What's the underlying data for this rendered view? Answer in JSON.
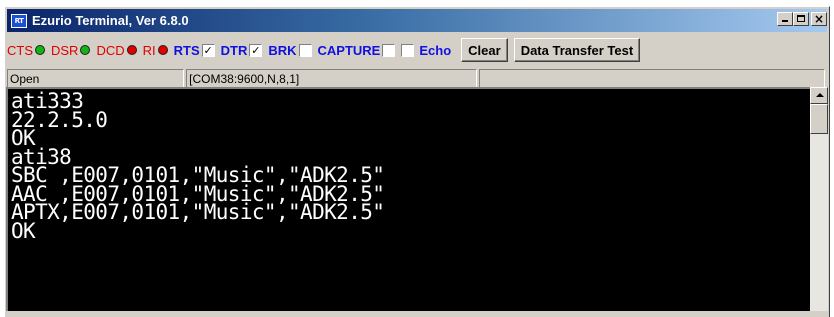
{
  "window": {
    "title": "Ezurio Terminal, Ver 6.8.0",
    "icon_text": "RT",
    "controls": [
      "minimize-icon",
      "maximize-icon",
      "close-icon"
    ],
    "close_glyph": "×"
  },
  "toolbar": {
    "cts": {
      "label": "CTS",
      "led": "green"
    },
    "dsr": {
      "label": "DSR",
      "led": "green"
    },
    "dcd": {
      "label": "DCD",
      "led": "red"
    },
    "ri": {
      "label": "RI",
      "led": "red"
    },
    "rts": {
      "label": "RTS",
      "checked": true,
      "mark": "✓"
    },
    "dtr": {
      "label": "DTR",
      "checked": true,
      "mark": "✓"
    },
    "brk": {
      "label": "BRK",
      "checked": false,
      "mark": ""
    },
    "capture": {
      "label": "CAPTURE",
      "checked": false,
      "mark": ""
    },
    "echo": {
      "label": "Echo",
      "checked": false,
      "mark": ""
    },
    "clear_label": "Clear",
    "data_transfer_label": "Data Transfer Test"
  },
  "status": {
    "port_state": "Open",
    "port_settings": "[COM38:9600,N,8,1]",
    "empty": ""
  },
  "terminal": {
    "lines": [
      "ati333",
      "22.2.5.0",
      "OK",
      "ati38",
      "SBC ,E007,0101,\"Music\",\"ADK2.5\"",
      "AAC ,E007,0101,\"Music\",\"ADK2.5\"",
      "APTX,E007,0101,\"Music\",\"ADK2.5\"",
      "OK"
    ]
  },
  "colors": {
    "led_green": "#12b312",
    "led_red": "#e00000",
    "signal_red_label": "#e00000",
    "signal_blue_label": "#1010e0",
    "terminal_bg": "#000000",
    "terminal_fg": "#ffffff",
    "titlebar_start": "#0a246a"
  }
}
